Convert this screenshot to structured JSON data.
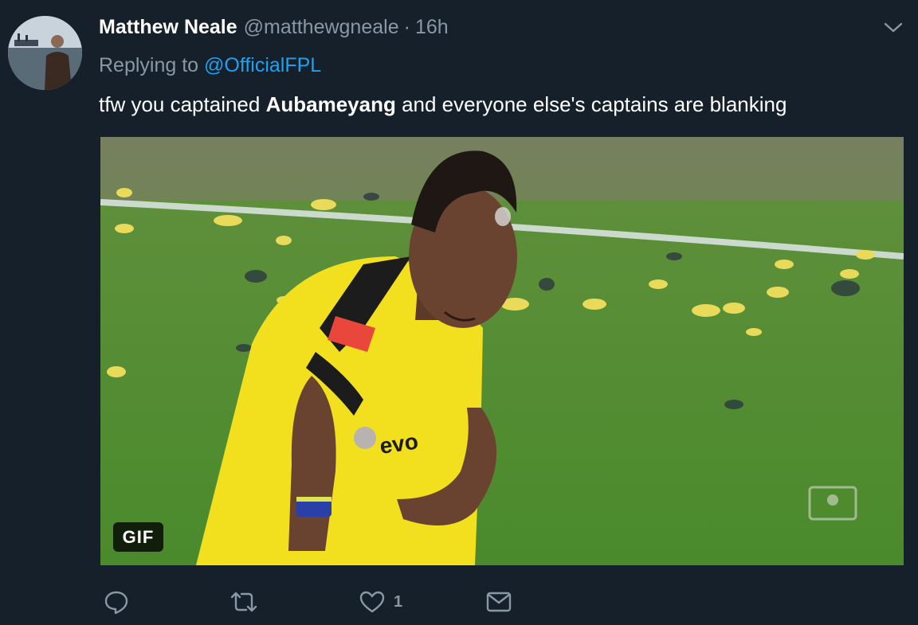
{
  "tweet": {
    "author_name": "Matthew Neale",
    "author_handle": "@matthewgneale",
    "separator": "·",
    "timestamp": "16h",
    "replying_prefix": "Replying to",
    "replying_to": "@OfficialFPL",
    "text_before": "tfw you captained ",
    "text_bold": "Aubameyang",
    "text_after": " and everyone else's captains are blanking",
    "media_badge": "GIF"
  },
  "actions": {
    "like_count": "1"
  },
  "icons": {
    "menu": "chevron-down-icon",
    "reply": "reply-icon",
    "retweet": "retweet-icon",
    "like": "heart-icon",
    "dm": "envelope-icon"
  },
  "colors": {
    "background": "#15202b",
    "text_primary": "#ffffff",
    "text_secondary": "#8899a6",
    "link": "#1da1f2",
    "kit_yellow": "#f2df1e",
    "pitch_green": "#4e8a2e"
  }
}
